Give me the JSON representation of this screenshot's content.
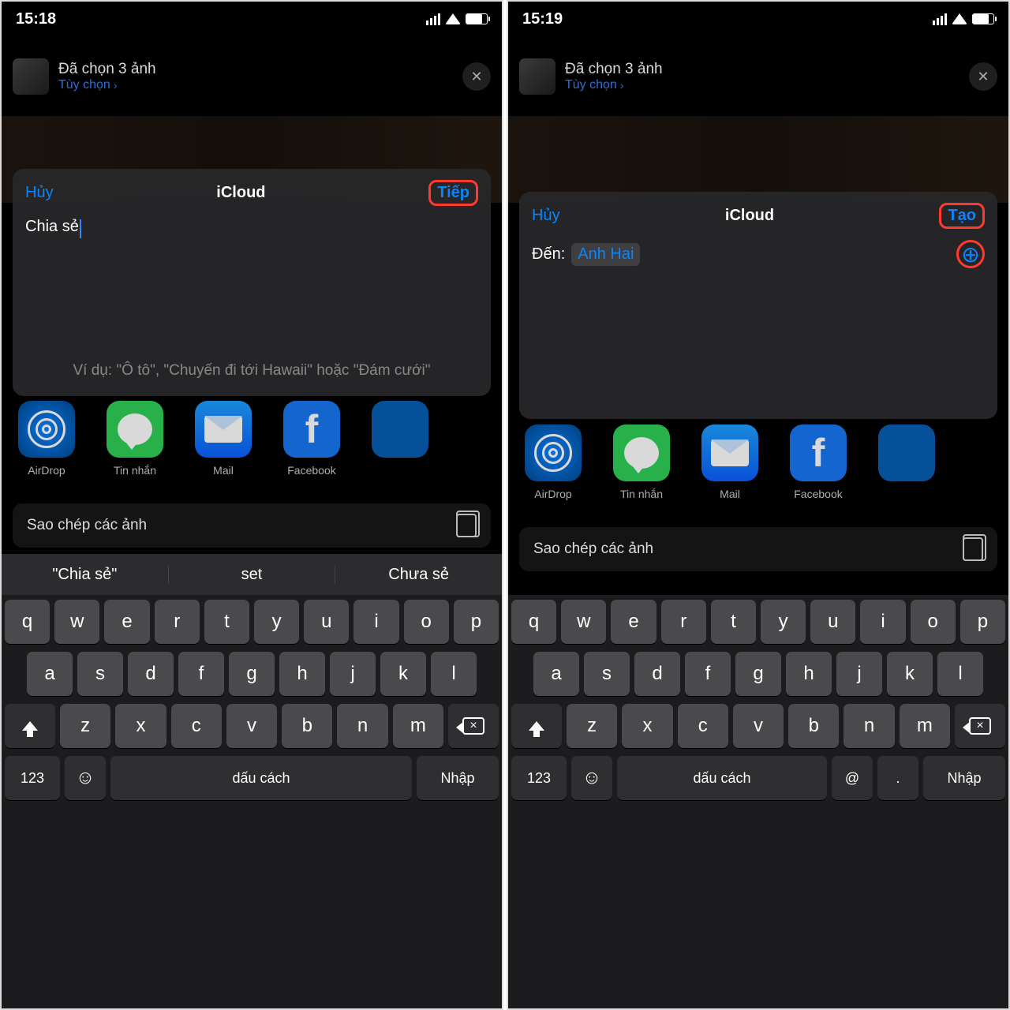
{
  "left": {
    "status_time": "15:18",
    "share_header": "Đã chọn 3 ảnh",
    "options": "Tùy chọn",
    "modal_cancel": "Hủy",
    "modal_title": "iCloud",
    "modal_next": "Tiếp",
    "input_value": "Chia sẻ",
    "example_hint": "Ví dụ: \"Ô tô\", \"Chuyến đi tới Hawaii\" hoặc \"Đám cưới\"",
    "suggestions": [
      "\"Chia sẻ\"",
      "set",
      "Chưa sẻ"
    ]
  },
  "right": {
    "status_time": "15:19",
    "share_header": "Đã chọn 3 ảnh",
    "options": "Tùy chọn",
    "modal_cancel": "Hủy",
    "modal_title": "iCloud",
    "modal_next": "Tạo",
    "to_label": "Đến:",
    "to_chip": "Anh Hai"
  },
  "apps": {
    "airdrop": "AirDrop",
    "messages": "Tin nhắn",
    "mail": "Mail",
    "facebook": "Facebook"
  },
  "copy_label": "Sao chép các ảnh",
  "keyboard": {
    "row1": [
      "q",
      "w",
      "e",
      "r",
      "t",
      "y",
      "u",
      "i",
      "o",
      "p"
    ],
    "row2": [
      "a",
      "s",
      "d",
      "f",
      "g",
      "h",
      "j",
      "k",
      "l"
    ],
    "row3": [
      "z",
      "x",
      "c",
      "v",
      "b",
      "n",
      "m"
    ],
    "num": "123",
    "space": "dấu cách",
    "return": "Nhập",
    "at": "@",
    "dot": "."
  }
}
